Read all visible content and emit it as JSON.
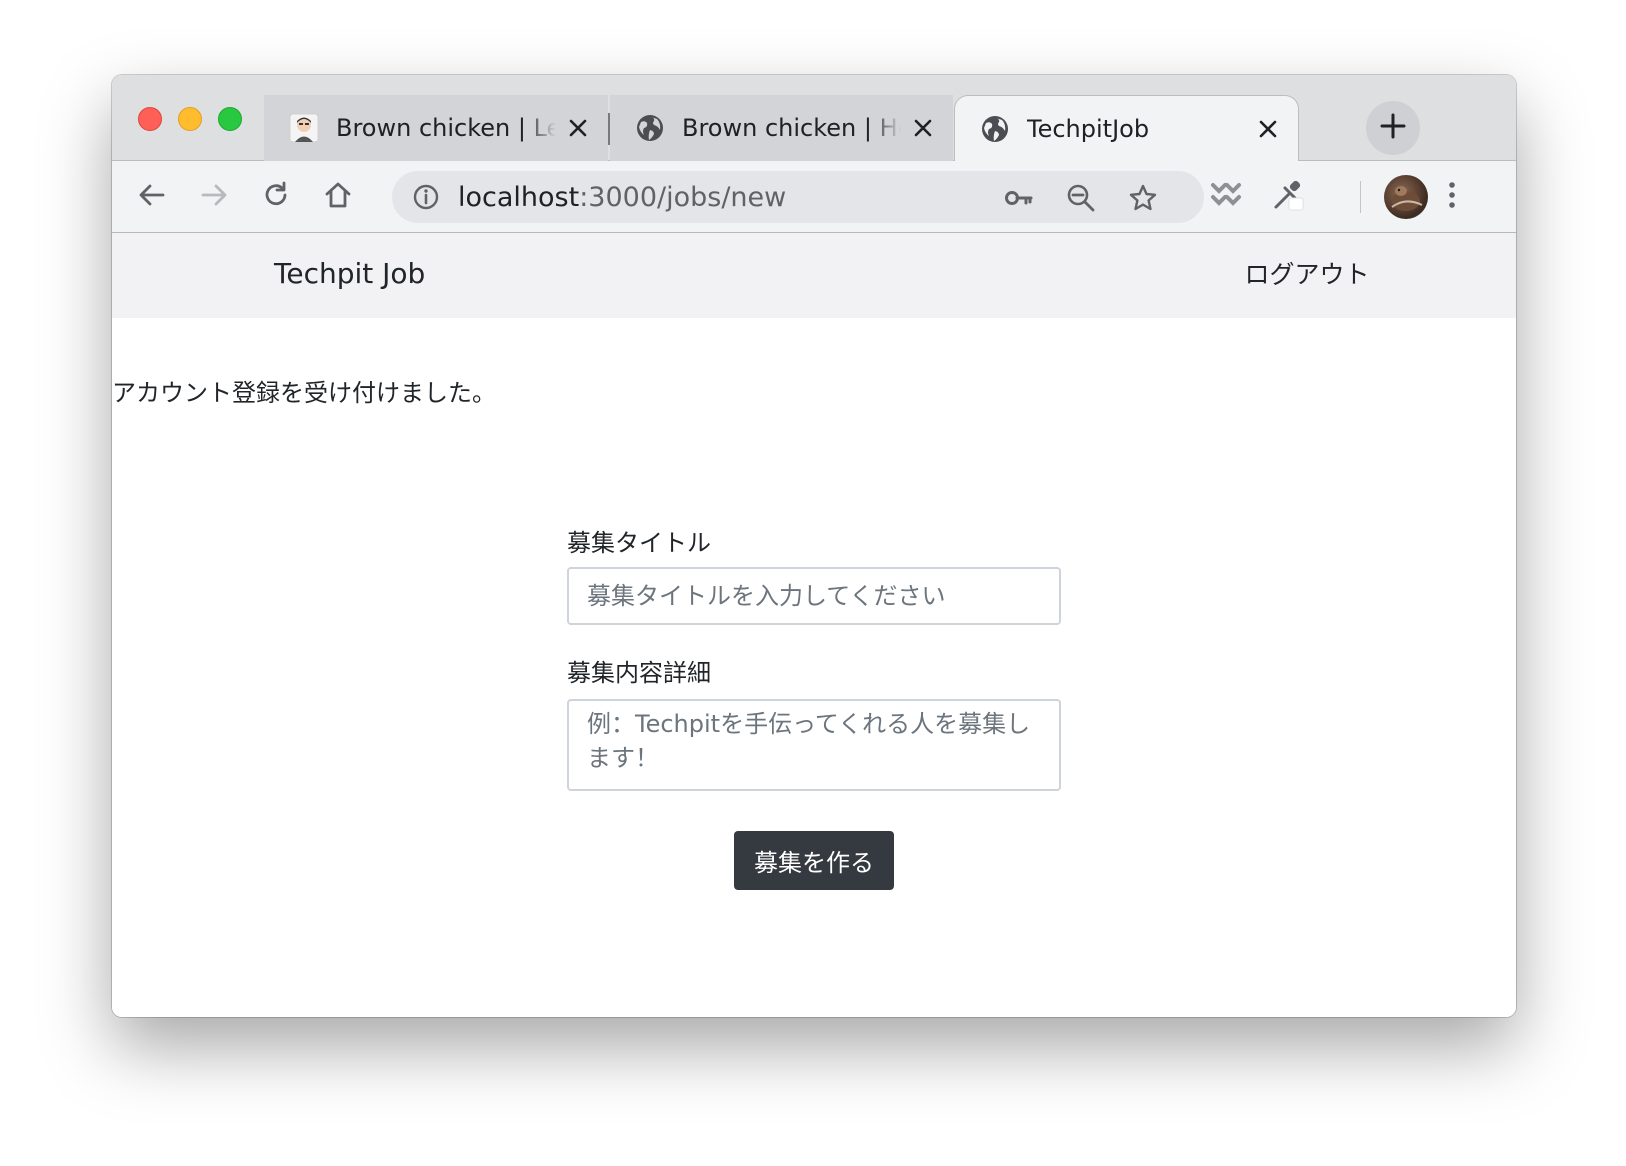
{
  "browser": {
    "tabs": [
      {
        "title": "Brown chicken | Learn",
        "favicon": "avatar-favicon-icon",
        "active": false
      },
      {
        "title": "Brown chicken | Home",
        "favicon": "globe-icon",
        "active": false
      },
      {
        "title": "TechpitJob",
        "favicon": "globe-icon",
        "active": true
      }
    ],
    "new_tab_icon": "plus-icon",
    "address": {
      "host": "localhost",
      "path": ":3000/jobs/new"
    },
    "toolbar_icons": [
      "back-arrow-icon",
      "forward-arrow-icon",
      "reload-icon",
      "home-icon",
      "info-icon",
      "key-icon",
      "zoom-out-icon",
      "star-icon",
      "extension-icon",
      "eyedropper-icon",
      "profile-avatar",
      "menu-dots-icon"
    ]
  },
  "navbar": {
    "brand": "Techpit Job",
    "logout": "ログアウト"
  },
  "flash": {
    "message": "アカウント登録を受け付けました。"
  },
  "form": {
    "title_label": "募集タイトル",
    "title_placeholder": "募集タイトルを入力してください",
    "title_value": "",
    "detail_label": "募集内容詳細",
    "detail_placeholder": "例：Techpitを手伝ってくれる人を募集します！",
    "detail_value": "",
    "submit_label": "募集を作る"
  },
  "colors": {
    "traffic_close": "#fe5f57",
    "traffic_min": "#febc2e",
    "traffic_max": "#28c840",
    "navbar_bg": "#f2f2f4",
    "button_bg": "#343a40"
  }
}
